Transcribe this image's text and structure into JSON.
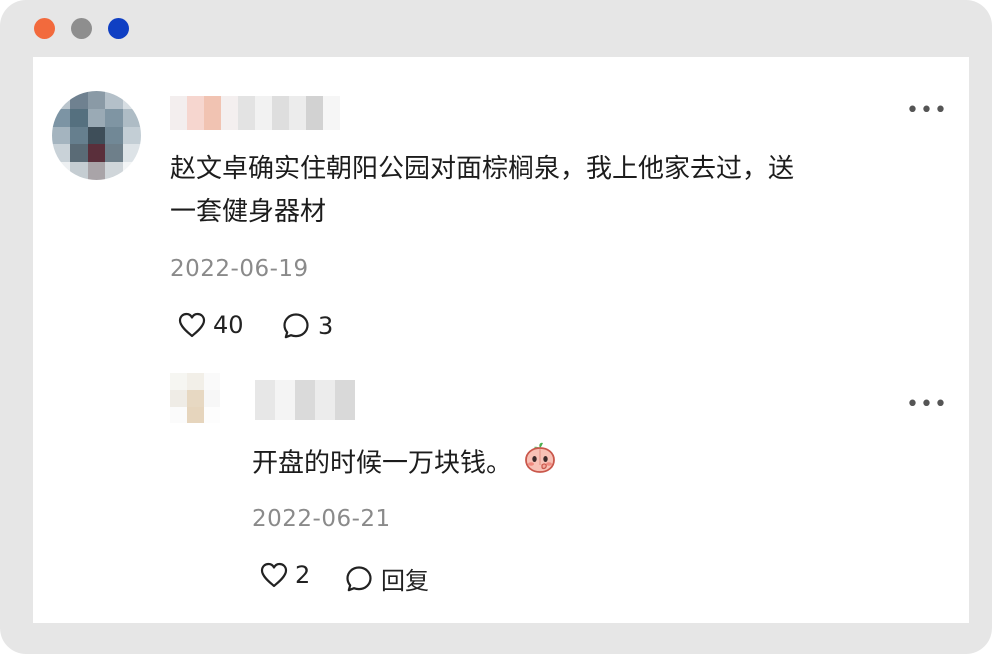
{
  "window": {
    "controls": [
      "close",
      "minimize",
      "maximize"
    ],
    "colors": {
      "close": "#f26a3d",
      "minimize": "#8e8e8e",
      "maximize": "#0f3fc3"
    }
  },
  "comment": {
    "text_line1": "赵文卓确实住朝阳公园对面棕榈泉，我上他家去过，送",
    "text_line2": "一套健身器材",
    "date": "2022-06-19",
    "likes": "40",
    "replies": "3"
  },
  "reply": {
    "text": "开盘的时候一万块钱。",
    "emoji": "peach-face-emoji",
    "date": "2022-06-21",
    "likes": "2",
    "reply_label": "回复"
  },
  "icons": [
    "more-icon",
    "heart-icon",
    "comment-icon"
  ]
}
